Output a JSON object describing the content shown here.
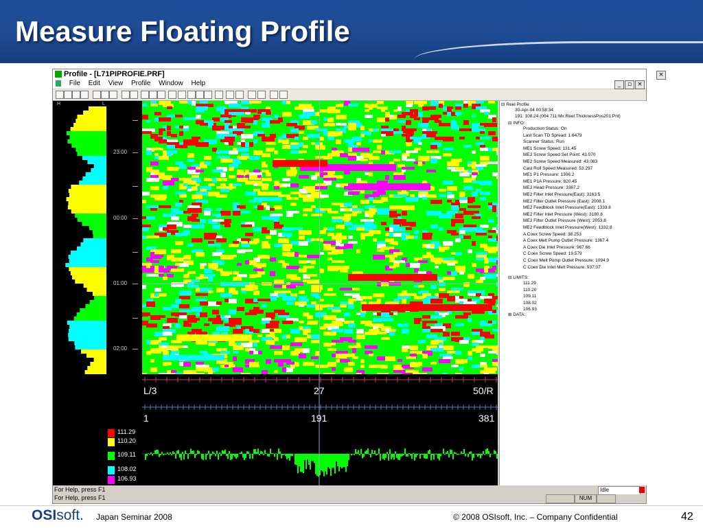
{
  "slide": {
    "title": "Measure Floating Profile",
    "footer_left": "Japan Seminar 2008",
    "footer_center": "© 2008 OSIsoft, Inc. – Company Confidential",
    "page_number": "42",
    "logo_bold": "OSI",
    "logo_rest": "soft."
  },
  "window": {
    "title": "Profile - [L71PIPROFIE.PRF]",
    "menu": [
      "File",
      "Edit",
      "View",
      "Profile",
      "Window",
      "Help"
    ]
  },
  "left_panel": {
    "h_label": "H",
    "l_label": "L",
    "times": [
      "23:00",
      "00:00",
      "01:00",
      "02:00"
    ]
  },
  "scales": {
    "top": {
      "left": "L/3",
      "middle": "27",
      "right": "50/R"
    },
    "bottom": {
      "left": "1",
      "middle": "191",
      "right": "381"
    }
  },
  "legend": [
    {
      "value": "111.29",
      "color": "#ff0000"
    },
    {
      "value": "110.20",
      "color": "#ffff00"
    },
    {
      "value": "109.11",
      "color": "#00ff00"
    },
    {
      "value": "108.02",
      "color": "#00ffff"
    },
    {
      "value": "106.93",
      "color": "#ff00ff"
    }
  ],
  "tree": {
    "root": "Reel Profile",
    "date": "30-Apr-04 00:58:34",
    "tag": "191: 108.24   (004:711:Mx:Reel:ThicknessPos201:Pnt)",
    "info_label": "INFO:",
    "info": [
      "Production Status: On",
      "Last Scan TD Spread: 1.6479",
      "Scanner Status: Run",
      "ME1 Screw Speed: 131.45",
      "ME2 Screw Speed Set Point: 43.070",
      "ME2 Screw Speed Measured: 43.083",
      "Cast Roll Speed Measured: 53.297",
      "ME1 P1 Pressure: 1306.2",
      "ME1 P1A Pressure: 820.45",
      "ME2 Head Pressure: 3367.2",
      "ME2 Filter Inlet Pressure(East): 3163.5",
      "ME2 Filter Outlet Pressure (East): 2008.1",
      "ME2 Feedblock Inlet Pressure(East): 1333.8",
      "ME2 Filter Inlet Pressure (West): 3180.8",
      "ME2 Filter Outlet Pressure (West): 2053.8",
      "ME2 Feedblock Inlet Pressure(West): 1332.8",
      "A Coex Screw Speed: 38.253",
      "A Coex Melt Pump Outlet Pressure: 1367.4",
      "A Coex Die Inlet Pressure: 967.66",
      "C Coex Screw Speed: 19.579",
      "C Coex Melt Pump Outlet Pressure: 1094.9",
      "C Coex Die Inlet Melt Pressure: 937.07"
    ],
    "limits_label": "LIMITS:",
    "limits": [
      "111.29",
      "110.20",
      "109.11",
      "108.02",
      "106.93"
    ],
    "data_label": "DATA:"
  },
  "status": {
    "help1": "For Help, press F1",
    "help2": "For Help, press F1",
    "idle": "Idle",
    "num": "NUM"
  },
  "icons": [
    "app-icon",
    "minimize-icon",
    "restore-icon",
    "close-icon"
  ]
}
